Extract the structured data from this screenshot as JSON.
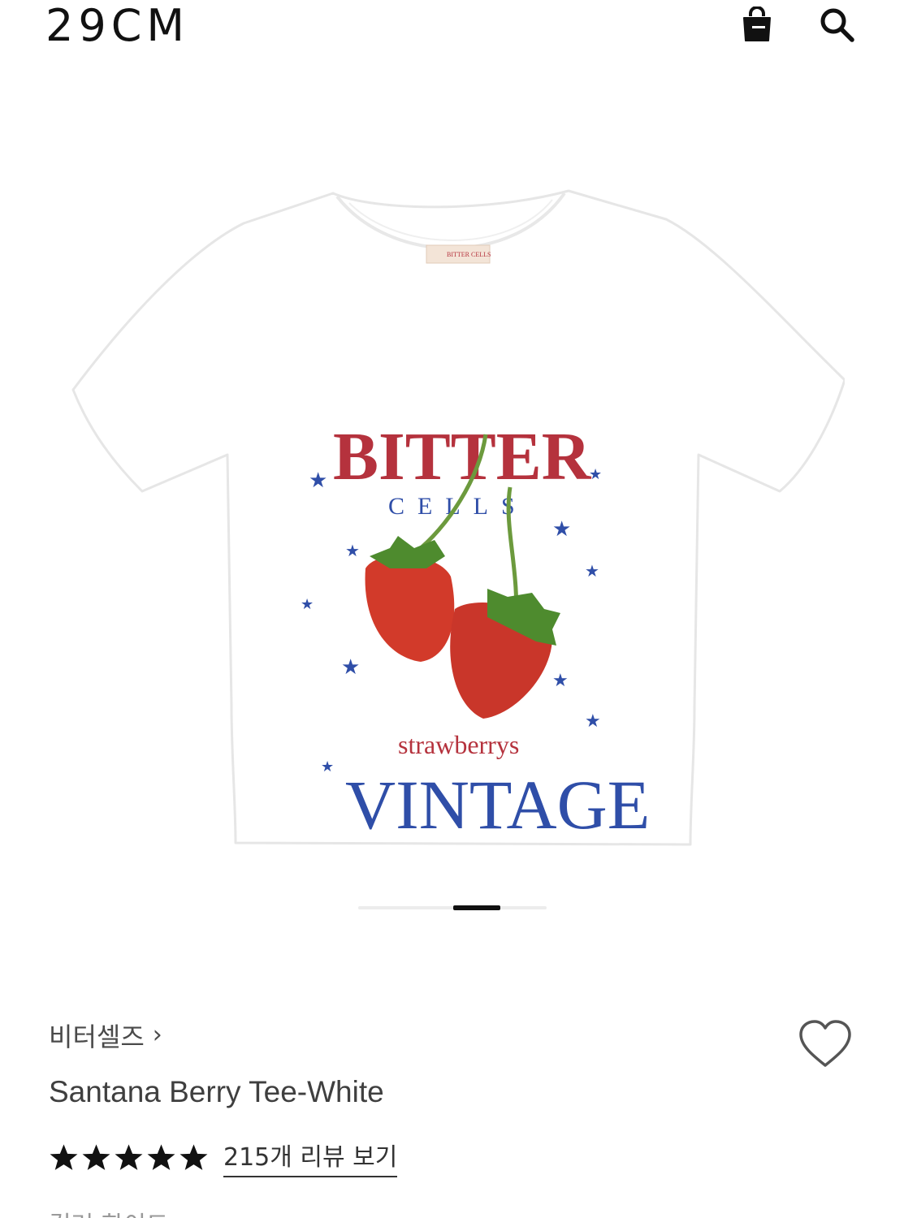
{
  "header": {
    "logo": "29CM",
    "cart_icon": "shopping-bag-icon",
    "search_icon": "search-icon"
  },
  "gallery": {
    "image_alt": "Santana Berry Tee-White",
    "print": {
      "brand_top": "BITTER",
      "brand_sub": "CELLS",
      "script_text": "strawberrys",
      "bottom_text": "VINTAGE",
      "neck_tag": "BITTER CELLS"
    },
    "pager_progress": 0.5
  },
  "product": {
    "brand": "비터셀즈",
    "brand_chevron": "›",
    "name": "Santana Berry Tee-White",
    "rating": 5,
    "review_link": "215개 리뷰 보기",
    "option_label": "컬러  화이트"
  },
  "colors": {
    "brand_red": "#b5323d",
    "brand_blue": "#2f4ea8",
    "strawberry": "#d23a2a",
    "leaf": "#4e8b2e"
  }
}
